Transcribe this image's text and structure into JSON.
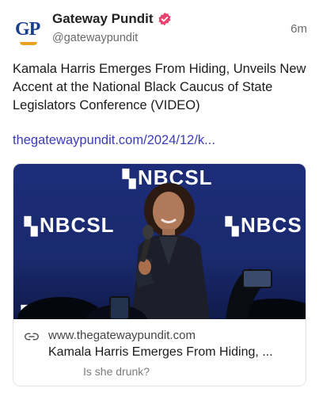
{
  "author": {
    "avatar_text": "GP",
    "display_name": "Gateway Pundit",
    "handle": "@gatewaypundit",
    "verified_icon": "verified-badge-icon",
    "verified_color": "#e8436e"
  },
  "post": {
    "timestamp": "6m",
    "text": "Kamala Harris Emerges From Hiding, Unveils New Accent at the National Black Caucus of State Legislators Conference (VIDEO)",
    "link": "thegatewaypundit.com/2024/12/k..."
  },
  "card": {
    "image_banner_text": "NBCSL",
    "image_banner_text_cut": "NBCS",
    "image_banner_text_short": "N",
    "link_icon": "link-icon",
    "domain": "www.thegatewaypundit.com",
    "title": "Kamala Harris Emerges From Hiding, ...",
    "description": "Is she drunk?"
  },
  "colors": {
    "link": "#3b3bbd",
    "brand_blue": "#1b3f8f",
    "brand_gold": "#e8a21c",
    "stage_blue": "#1d2c78"
  }
}
